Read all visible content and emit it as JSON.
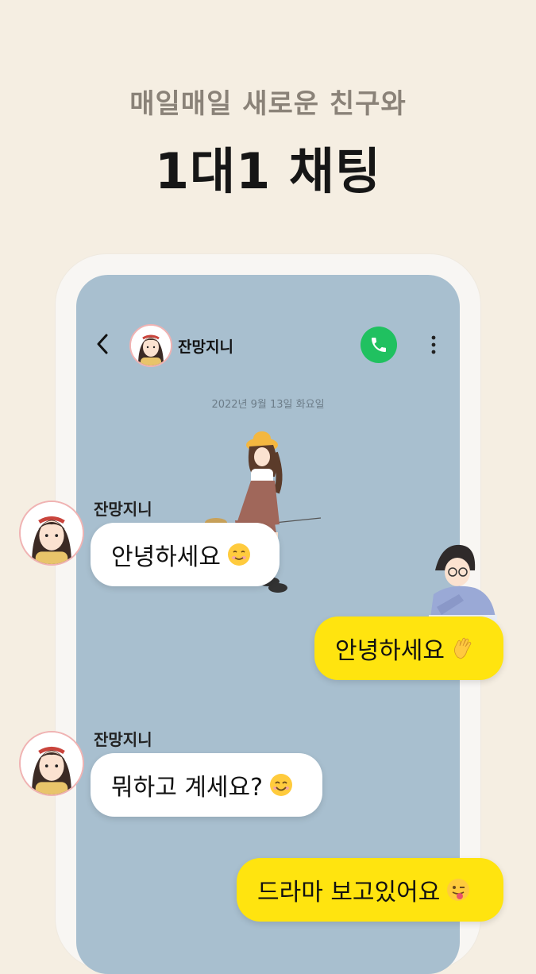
{
  "headline": {
    "sub": "매일매일 새로운 친구와",
    "main": "1대1 채팅"
  },
  "chat_header": {
    "partner_name": "잔망지니",
    "icons": [
      "back-arrow-icon",
      "profile-avatar",
      "phone-call-icon",
      "more-vertical-icon"
    ]
  },
  "date_divider": "2022년 9월 13일 화요일",
  "messages": [
    {
      "sender": "잔망지니",
      "text": "안녕하세요",
      "emoji": "smiling-face-icon",
      "side": "left"
    },
    {
      "sender": "",
      "text": "안녕하세요",
      "emoji": "waving-hand-icon",
      "side": "right"
    },
    {
      "sender": "잔망지니",
      "text": "뭐하고 계세요?",
      "emoji": "smiley-face-icon",
      "side": "left"
    },
    {
      "sender": "",
      "text": "드라마 보고있어요",
      "emoji": "winking-tongue-face-icon",
      "side": "right"
    }
  ],
  "colors": {
    "background": "#f5eee2",
    "chat_background": "#a8bfcf",
    "my_bubble": "#ffe40f",
    "their_bubble": "#ffffff",
    "call_button": "#20c160"
  }
}
